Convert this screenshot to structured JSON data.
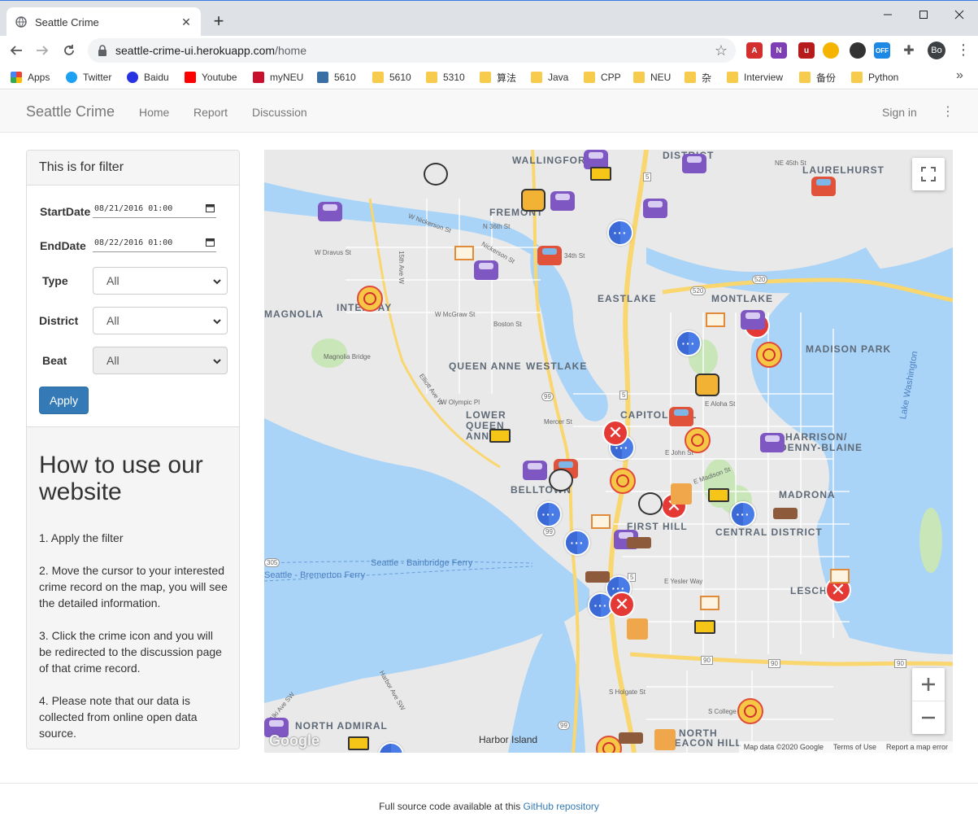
{
  "browser": {
    "tab_title": "Seattle Crime",
    "url_host": "seattle-crime-ui.herokuapp.com",
    "url_path": "/home",
    "profile_initials": "Bo",
    "extension_badge": "OFF",
    "bookmarks": [
      "Apps",
      "Twitter",
      "Baidu",
      "Youtube",
      "myNEU",
      "5610",
      "5610",
      "5310",
      "算法",
      "Java",
      "CPP",
      "NEU",
      "杂",
      "Interview",
      "备份",
      "Python"
    ]
  },
  "navbar": {
    "brand": "Seattle Crime",
    "links": [
      "Home",
      "Report",
      "Discussion"
    ],
    "signin": "Sign in"
  },
  "filter": {
    "heading": "This is for filter",
    "start_label": "StartDate",
    "start_value": "08/21/2016 01:00",
    "end_label": "EndDate",
    "end_value": "08/22/2016 01:00",
    "type_label": "Type",
    "type_value": "All",
    "district_label": "District",
    "district_value": "All",
    "beat_label": "Beat",
    "beat_value": "All",
    "apply": "Apply"
  },
  "howto": {
    "title": "How to use our website",
    "steps": [
      "1. Apply the filter",
      "2. Move the cursor to your interested crime record on the map, you will see the detailed information.",
      "3. Click the crime icon and you will be redirected to the discussion page of that crime record.",
      "4. Please note that our data is collected from online open data source."
    ]
  },
  "map": {
    "neighborhoods": [
      "WALLINGFORD",
      "LAURELHURST",
      "FREMONT",
      "EASTLAKE",
      "MONTLAKE",
      "MAGNOLIA",
      "INTERBAY",
      "MADISON PARK",
      "QUEEN ANNE",
      "WESTLAKE",
      "CAPITOL HILL",
      "LOWER QUEEN ANNE",
      "HARRISON/",
      "DENNY-BLAINE",
      "BELLTOWN",
      "MADRONA",
      "FIRST HILL",
      "CENTRAL DISTRICT",
      "LESCHI",
      "NORTH ADMIRAL",
      "NORTH",
      "BEACON HILL",
      "DISTRICT"
    ],
    "water_labels": [
      "Seattle - Bainbridge Ferry",
      "Seattle - Bremerton Ferry",
      "Lake Washington",
      "Harbor Island"
    ],
    "streets": [
      "NE 45th St",
      "N 36th St",
      "34th St",
      "W Nickerson St",
      "Nickerson St",
      "W Dravus St",
      "W McGraw St",
      "Boston St",
      "Magnolia Bridge",
      "W Olympic Pl",
      "Mercer St",
      "E Aloha St",
      "E John St",
      "E Madison St",
      "E Yesler Way",
      "S Holgate St",
      "S College St",
      "Elliott Ave W",
      "15th Ave W",
      "Alki Ave SW",
      "Harbor Ave SW"
    ],
    "route_shields": [
      "5",
      "520",
      "520",
      "99",
      "5",
      "99",
      "305",
      "5",
      "90",
      "90",
      "90",
      "99"
    ],
    "attribution": [
      "Map data ©2020 Google",
      "Terms of Use",
      "Report a map error"
    ],
    "google": "Google",
    "colors": {
      "water": "#a9d3f7",
      "land": "#e9e9e9",
      "highway": "#f9d66e",
      "park": "#c8e6b8"
    }
  },
  "footer": {
    "text": "Full source code available at this ",
    "link": "GitHub repository"
  }
}
